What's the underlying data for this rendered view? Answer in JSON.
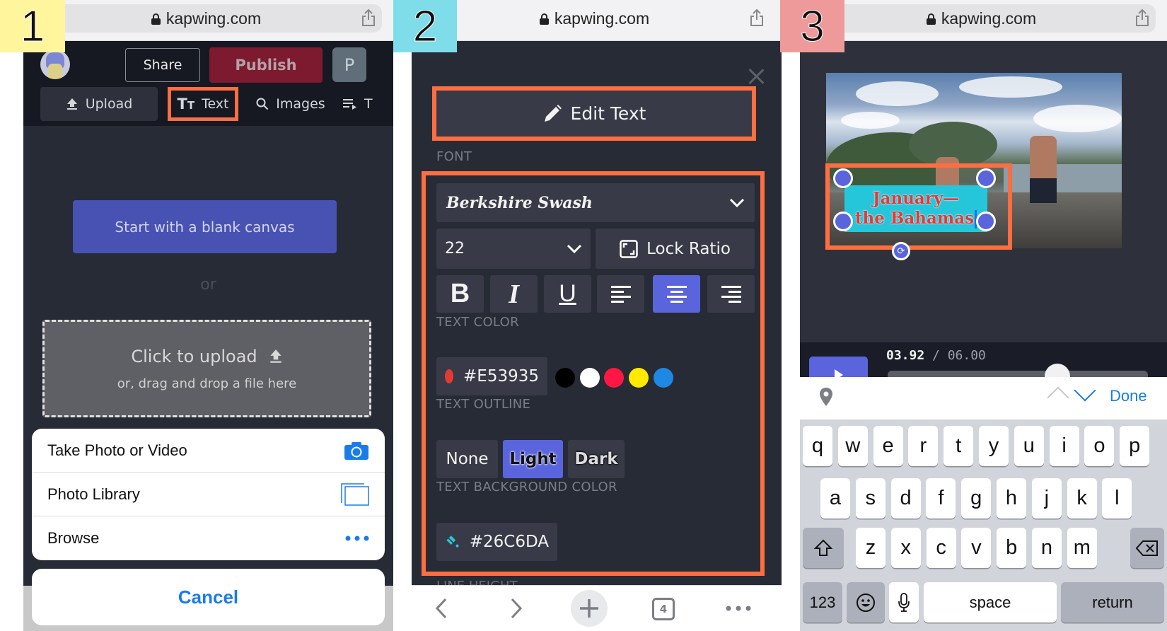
{
  "steps": [
    "1",
    "2",
    "3"
  ],
  "browser": {
    "url": "kapwing.com",
    "tab_count": "4"
  },
  "panel1": {
    "header": {
      "share_label": "Share",
      "publish_label": "Publish",
      "profile_initial": "P"
    },
    "tabs": [
      {
        "label": "Upload",
        "icon": "upload-icon"
      },
      {
        "label": "Text",
        "icon": "text-icon"
      },
      {
        "label": "Images",
        "icon": "search-icon"
      },
      {
        "label": "T",
        "icon": "playlist-icon"
      }
    ],
    "blank_canvas_label": "Start with a blank canvas",
    "or_label": "or",
    "dropzone": {
      "title": "Click to upload",
      "subtitle": "or, drag and drop a file here"
    },
    "action_sheet": {
      "items": [
        {
          "label": "Take Photo or Video",
          "icon": "camera-icon"
        },
        {
          "label": "Photo Library",
          "icon": "photo-library-icon"
        },
        {
          "label": "Browse",
          "icon": "more-icon"
        }
      ],
      "cancel_label": "Cancel"
    }
  },
  "panel2": {
    "edit_text_label": "Edit Text",
    "font_label": "FONT",
    "font_value": "Berkshire Swash",
    "size_value": "22",
    "lock_ratio_label": "Lock Ratio",
    "format_buttons": [
      {
        "name": "bold",
        "glyph": "B",
        "active": false
      },
      {
        "name": "italic",
        "glyph": "I",
        "active": false
      },
      {
        "name": "underline",
        "glyph": "U",
        "active": false
      },
      {
        "name": "align-left",
        "active": false
      },
      {
        "name": "align-center",
        "active": true
      },
      {
        "name": "align-right",
        "active": false
      }
    ],
    "text_color_label": "TEXT COLOR",
    "text_color_value": "#E53935",
    "preset_colors": [
      "#000000",
      "#FFFFFF",
      "#FF1744",
      "#FFEA00",
      "#1E88E5"
    ],
    "text_outline_label": "TEXT OUTLINE",
    "outline_options": [
      "None",
      "Light",
      "Dark"
    ],
    "outline_selected": "Light",
    "bg_color_label": "TEXT BACKGROUND COLOR",
    "bg_color_value": "#26C6DA",
    "line_height_label": "LINE HEIGHT"
  },
  "panel3": {
    "text_line1": "January—",
    "text_line2": "the Bahamas",
    "time_current": "03.92",
    "time_separator": " / ",
    "time_total": "06.00",
    "playback_progress": 0.653,
    "keyboard": {
      "done_label": "Done",
      "row1": [
        "q",
        "w",
        "e",
        "r",
        "t",
        "y",
        "u",
        "i",
        "o",
        "p"
      ],
      "row2": [
        "a",
        "s",
        "d",
        "f",
        "g",
        "h",
        "j",
        "k",
        "l"
      ],
      "row3": [
        "z",
        "x",
        "c",
        "v",
        "b",
        "n",
        "m"
      ],
      "numbers_label": "123",
      "space_label": "space",
      "return_label": "return"
    }
  },
  "colors": {
    "accent": "#5A64DC",
    "highlight": "#FF6E40",
    "publish": "#7D1A30",
    "ios_blue": "#1A7CE8"
  }
}
